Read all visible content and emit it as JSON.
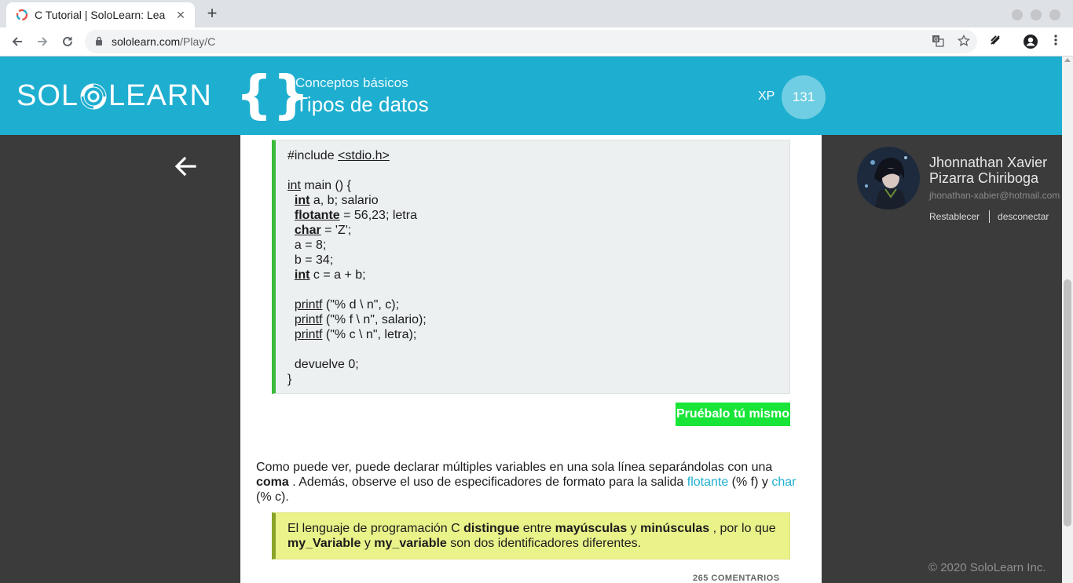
{
  "browser": {
    "tab_title": "C Tutorial | SoloLearn: Lea",
    "tab_close": "✕",
    "new_tab": "+",
    "url_host": "sololearn.com",
    "url_path": "/Play/C"
  },
  "header": {
    "logo_left": "SOL",
    "logo_right": "LEARN",
    "braces": "{}",
    "module_name": "Conceptos básicos",
    "lesson_name": "Tipos de datos",
    "xp_label": "XP",
    "xp_value": "131",
    "accent_color": "#1eaed0"
  },
  "lesson": {
    "code_lines": [
      {
        "pre": "#include ",
        "kw": "",
        "ul": "<stdio.h>",
        "post": ""
      },
      {
        "pre": "",
        "kw": "",
        "ul": "",
        "post": ""
      },
      {
        "pre": "",
        "kw": "",
        "ul": "int",
        "post": " main () {"
      },
      {
        "pre": "  ",
        "kw": "int",
        "ul": "",
        "post": " a, b; salario"
      },
      {
        "pre": "  ",
        "kw": "flotante",
        "ul": "",
        "post": " = 56,23; letra"
      },
      {
        "pre": "  ",
        "kw": "char",
        "ul": "",
        "post": " = 'Z';"
      },
      {
        "pre": "  a = 8;",
        "kw": "",
        "ul": "",
        "post": ""
      },
      {
        "pre": "  b = 34;",
        "kw": "",
        "ul": "",
        "post": ""
      },
      {
        "pre": "  ",
        "kw": "int",
        "ul": "",
        "post": " c = a + b;"
      },
      {
        "pre": "",
        "kw": "",
        "ul": "",
        "post": ""
      },
      {
        "pre": "  ",
        "kw": "",
        "ul": "printf",
        "post": " (\"% d \\ n\", c);"
      },
      {
        "pre": "  ",
        "kw": "",
        "ul": "printf",
        "post": " (\"% f \\ n\", salario);"
      },
      {
        "pre": "  ",
        "kw": "",
        "ul": "printf",
        "post": " (\"% c \\ n\", letra);"
      },
      {
        "pre": "",
        "kw": "",
        "ul": "",
        "post": ""
      },
      {
        "pre": "  devuelve 0;",
        "kw": "",
        "ul": "",
        "post": ""
      },
      {
        "pre": "}",
        "kw": "",
        "ul": "",
        "post": ""
      }
    ],
    "try_button": "Pruébalo tú mismo",
    "paragraph": {
      "p1": "Como puede ver, puede declarar múltiples variables en una sola línea separándolas con una ",
      "b1": "coma",
      "p2": " . Además, observe el uso de especificadores de formato para la salida ",
      "link1": "flotante",
      "p3": " (% f) y ",
      "link2": "char",
      "p4": " (% c)."
    },
    "note": {
      "t1": "El lenguaje de programación C ",
      "b1": "distingue",
      "t2": " entre ",
      "b2": "mayúsculas",
      "t3": " y ",
      "b3": "minúsculas",
      "t4": " , por lo que ",
      "b4": "my_Variable",
      "t5": " y ",
      "b5": "my_variable",
      "t6": " son dos identificadores diferentes."
    },
    "comments_label": "265 COMENTARIOS"
  },
  "profile": {
    "name": "Jhonnathan Xavier Pizarra Chiriboga",
    "email": "jhonathan-xabier@hotmail.com",
    "reset_label": "Restablecer",
    "logout_label": "desconectar",
    "copyright": "© 2020 SoloLearn Inc."
  }
}
